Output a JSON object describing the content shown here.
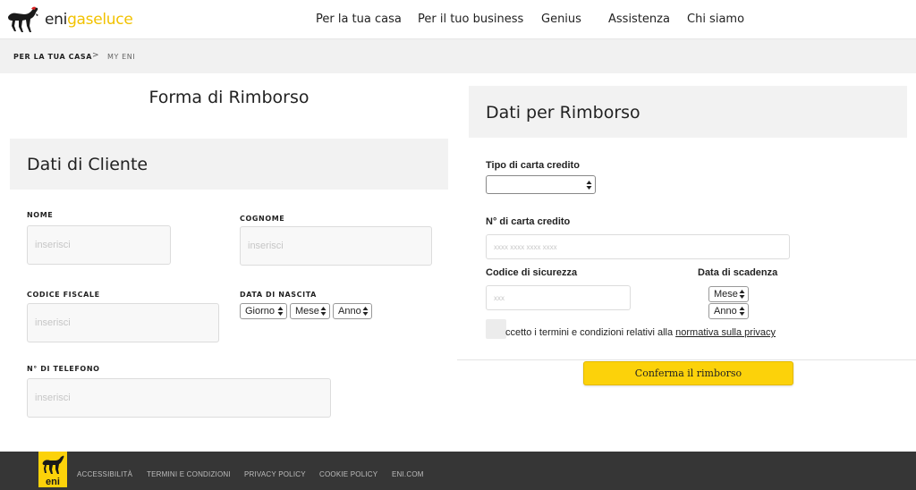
{
  "header": {
    "brand_part1": "eni",
    "brand_part2": "gaseluce",
    "nav": [
      {
        "label": "Per la tua casa"
      },
      {
        "label": "Per il tuo business"
      },
      {
        "label": "Genius"
      },
      {
        "label": "Assistenza"
      },
      {
        "label": "Chi siamo"
      }
    ]
  },
  "breadcrumb": {
    "root": "PER LA TUA CASA",
    "separator": ">",
    "current": "MY ENI"
  },
  "form": {
    "title": "Forma di Rimborso"
  },
  "client_panel": {
    "title": "Dati di Cliente",
    "nome_label": "NOME",
    "nome_placeholder": "inserisci",
    "cognome_label": "COGNOME",
    "cognome_placeholder": "inserisci",
    "cf_label": "CODICE FISCALE",
    "cf_placeholder": "inserisci",
    "dob_label": "DATA DI NASCITA",
    "dob_day": "Giorno",
    "dob_month": "Mese",
    "dob_year": "Anno",
    "tel_label": "N° DI TELEFONO",
    "tel_placeholder": "inserisci"
  },
  "refund_panel": {
    "title": "Dati per Rimborso",
    "card_type_label": "Tipo di carta credito",
    "card_type_value": "",
    "card_number_label": "N° di carta credito",
    "card_number_placeholder": "xxxx xxxx xxxx xxxx",
    "cvv_label": "Codice di sicurezza",
    "cvv_placeholder": "xxx",
    "expiry_label": "Data di scadenza",
    "expiry_month": "Mese",
    "expiry_year": "Anno",
    "terms_text": "ccetto i termini e condizioni relativi alla ",
    "terms_link": "normativa sulla privacy",
    "confirm_label": "Conferma il rimborso"
  },
  "footer": {
    "logo_text": "eni",
    "links": [
      {
        "label": "ACCESSIBILITÀ"
      },
      {
        "label": "TERMINI E CONDIZIONI"
      },
      {
        "label": "PRIVACY POLICY"
      },
      {
        "label": "COOKIE POLICY"
      },
      {
        "label": "ENI.COM"
      }
    ]
  },
  "colors": {
    "brand_yellow": "#fcd20a",
    "footer_bg": "#363636",
    "panel_bg": "#f2f2f2"
  }
}
